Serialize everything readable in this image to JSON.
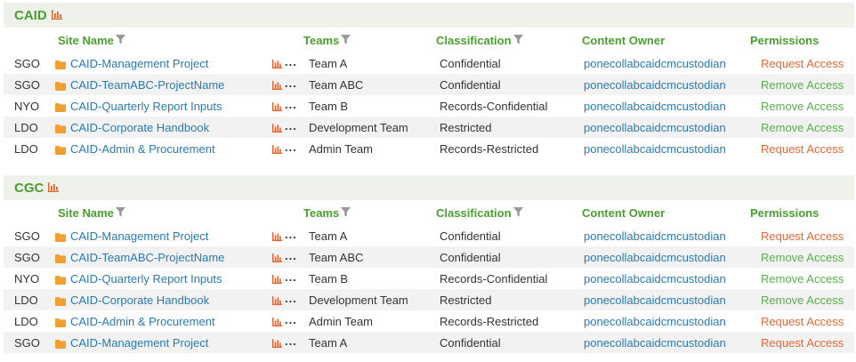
{
  "sections": [
    {
      "title": "CAID",
      "chart_icon": "bar-chart-icon",
      "columns": {
        "site": "Site Name",
        "teams": "Teams",
        "classification": "Classification",
        "owner": "Content Owner",
        "permissions": "Permissions"
      },
      "rows": [
        {
          "loc": "SGO",
          "site": "CAID-Management Project",
          "team": "Team A",
          "class": "Confidential",
          "owner": "ponecollabcaidcmcustodian",
          "perm": "Request Access",
          "perm_type": "request"
        },
        {
          "loc": "SGO",
          "site": "CAID-TeamABC-ProjectName",
          "team": "Team ABC",
          "class": "Confidential",
          "owner": "ponecollabcaidcmcustodian",
          "perm": "Remove Access",
          "perm_type": "remove"
        },
        {
          "loc": "NYO",
          "site": "CAID-Quarterly Report Inputs",
          "team": "Team B",
          "class": "Records-Confidential",
          "owner": "ponecollabcaidcmcustodian",
          "perm": "Remove Access",
          "perm_type": "remove"
        },
        {
          "loc": "LDO",
          "site": "CAID-Corporate Handbook",
          "team": "Development Team",
          "class": "Restricted",
          "owner": "ponecollabcaidcmcustodian",
          "perm": "Remove Access",
          "perm_type": "remove"
        },
        {
          "loc": "LDO",
          "site": "CAID-Admin & Procurement",
          "team": "Admin Team",
          "class": "Records-Restricted",
          "owner": "ponecollabcaidcmcustodian",
          "perm": "Request Access",
          "perm_type": "request"
        }
      ]
    },
    {
      "title": "CGC",
      "chart_icon": "bar-chart-icon",
      "columns": {
        "site": "Site Name",
        "teams": "Teams",
        "classification": "Classification",
        "owner": "Content Owner",
        "permissions": "Permissions"
      },
      "rows": [
        {
          "loc": "SGO",
          "site": "CAID-Management Project",
          "team": "Team A",
          "class": "Confidential",
          "owner": "ponecollabcaidcmcustodian",
          "perm": "Request Access",
          "perm_type": "request"
        },
        {
          "loc": "SGO",
          "site": "CAID-TeamABC-ProjectName",
          "team": "Team ABC",
          "class": "Confidential",
          "owner": "ponecollabcaidcmcustodian",
          "perm": "Remove Access",
          "perm_type": "remove"
        },
        {
          "loc": "NYO",
          "site": "CAID-Quarterly Report Inputs",
          "team": "Team B",
          "class": "Records-Confidential",
          "owner": "ponecollabcaidcmcustodian",
          "perm": "Remove Access",
          "perm_type": "remove"
        },
        {
          "loc": "LDO",
          "site": "CAID-Corporate Handbook",
          "team": "Development Team",
          "class": "Restricted",
          "owner": "ponecollabcaidcmcustodian",
          "perm": "Remove Access",
          "perm_type": "remove"
        },
        {
          "loc": "LDO",
          "site": "CAID-Admin & Procurement",
          "team": "Admin Team",
          "class": "Records-Restricted",
          "owner": "ponecollabcaidcmcustodian",
          "perm": "Request Access",
          "perm_type": "request"
        },
        {
          "loc": "SGO",
          "site": "CAID-Management Project",
          "team": "Team A",
          "class": "Confidential",
          "owner": "ponecollabcaidcmcustodian",
          "perm": "Request Access",
          "perm_type": "request"
        }
      ]
    }
  ],
  "row_more_label": "...",
  "colors": {
    "accent_green": "#4a9e2f",
    "link_blue": "#2a7ab0",
    "request_orange": "#e06a3a",
    "remove_green": "#57b04a",
    "folder_orange": "#f0a030",
    "chart_orange": "#e8632a"
  }
}
